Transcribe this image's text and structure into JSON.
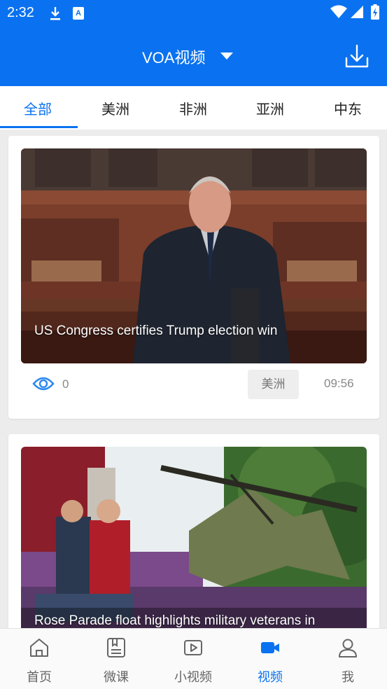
{
  "status_bar": {
    "time": "2:32",
    "a_badge": "A"
  },
  "header": {
    "title": "VOA视频"
  },
  "tabs": [
    {
      "label": "全部",
      "active": true
    },
    {
      "label": "美洲",
      "active": false
    },
    {
      "label": "非洲",
      "active": false
    },
    {
      "label": "亚洲",
      "active": false
    },
    {
      "label": "中东",
      "active": false
    }
  ],
  "videos": [
    {
      "title": "US Congress certifies Trump election win",
      "views": "0",
      "region": "美洲",
      "duration": "09:56"
    },
    {
      "title": "Rose Parade float highlights military veterans in",
      "views": "",
      "region": "",
      "duration": ""
    }
  ],
  "bottom_nav": [
    {
      "label": "首页",
      "icon": "home-icon",
      "active": false
    },
    {
      "label": "微课",
      "icon": "lesson-icon",
      "active": false
    },
    {
      "label": "小视频",
      "icon": "short-video-icon",
      "active": false
    },
    {
      "label": "视频",
      "icon": "video-camera-icon",
      "active": true
    },
    {
      "label": "我",
      "icon": "profile-icon",
      "active": false
    }
  ],
  "colors": {
    "accent": "#0a72f0",
    "background": "#ececec"
  }
}
